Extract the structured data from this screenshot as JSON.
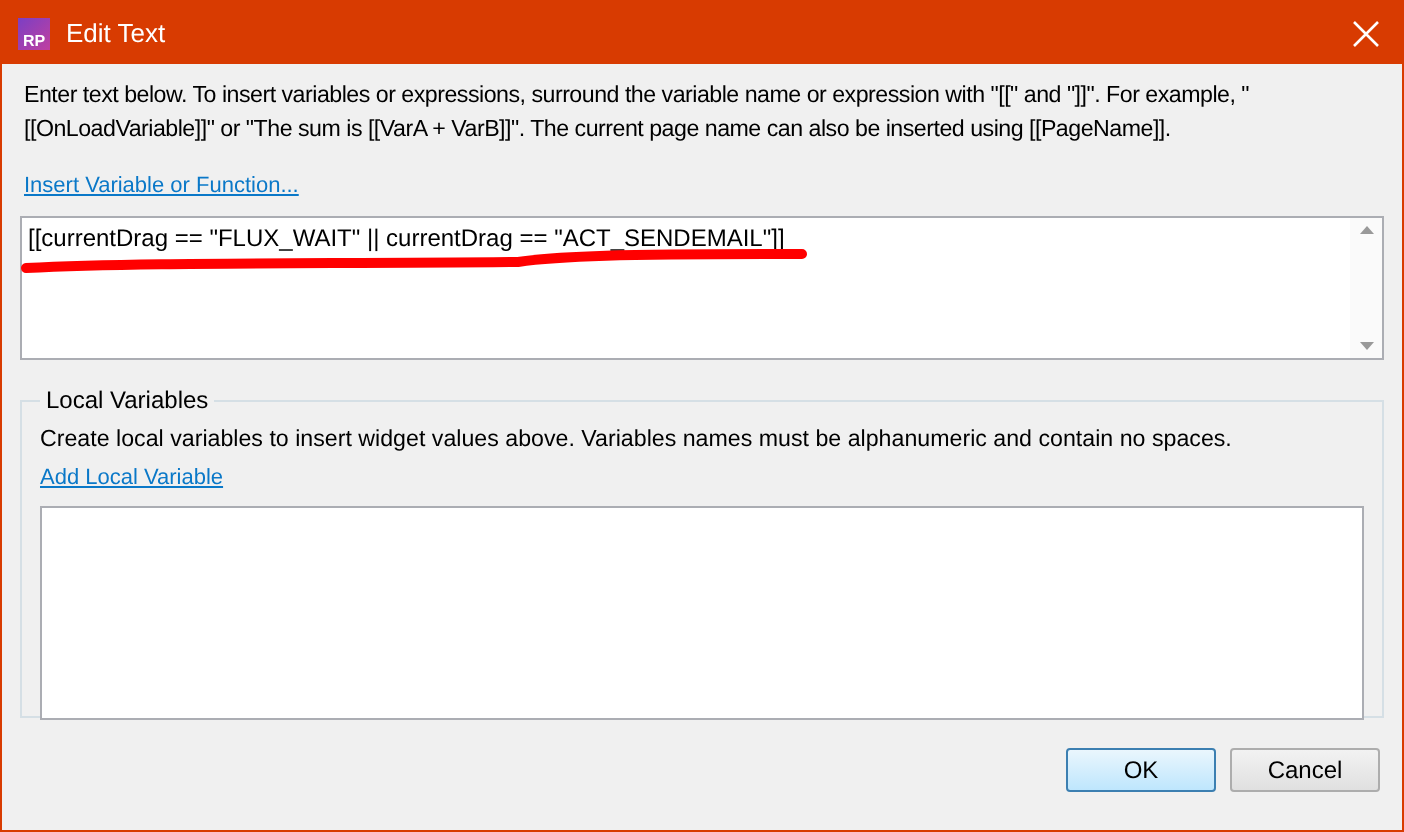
{
  "window": {
    "title": "Edit Text",
    "app_badge": "RP"
  },
  "instructions": "Enter text below. To insert variables or expressions, surround the variable name or expression with \"[[\" and \"]]\". For example, \"[[OnLoadVariable]]\" or \"The sum is [[VarA + VarB]]\". The current page name can also be inserted using [[PageName]].",
  "insert_link": "Insert Variable or Function...",
  "editor": {
    "value": "[[currentDrag == \"FLUX_WAIT\" || currentDrag == \"ACT_SENDEMAIL\"]]"
  },
  "local_variables": {
    "title": "Local Variables",
    "description": "Create local variables to insert widget values above. Variables names must be alphanumeric and contain no spaces.",
    "add_link": "Add Local Variable"
  },
  "buttons": [
    {
      "label": "OK",
      "default": true
    },
    {
      "label": "Cancel",
      "default": false
    }
  ]
}
